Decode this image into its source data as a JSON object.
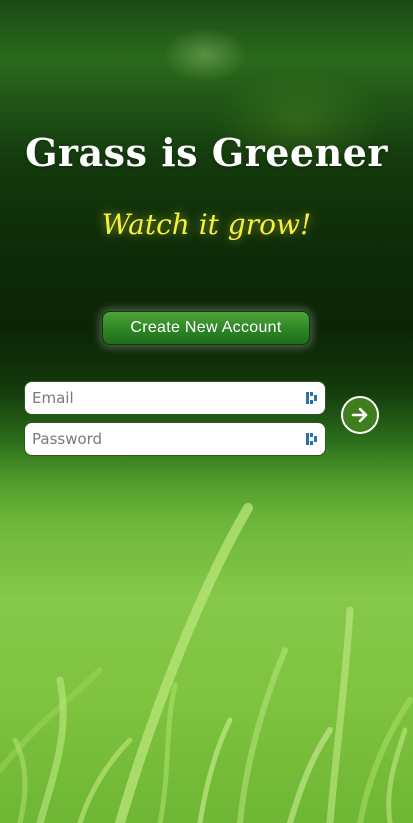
{
  "header": {
    "title": "Grass is Greener",
    "tagline": "Watch it grow!"
  },
  "actions": {
    "create_account_label": "Create New Account"
  },
  "login": {
    "email_placeholder": "Email",
    "email_value": "",
    "password_placeholder": "Password",
    "password_value": ""
  },
  "icons": {
    "email_field_icon": "password-manager-key-icon",
    "password_field_icon": "password-manager-key-icon",
    "submit_icon": "arrow-right-circle-icon"
  },
  "colors": {
    "title": "#ffffff",
    "tagline": "#f4f03c",
    "button_green": "#2f8726",
    "submit_green": "#3f7d1f"
  }
}
